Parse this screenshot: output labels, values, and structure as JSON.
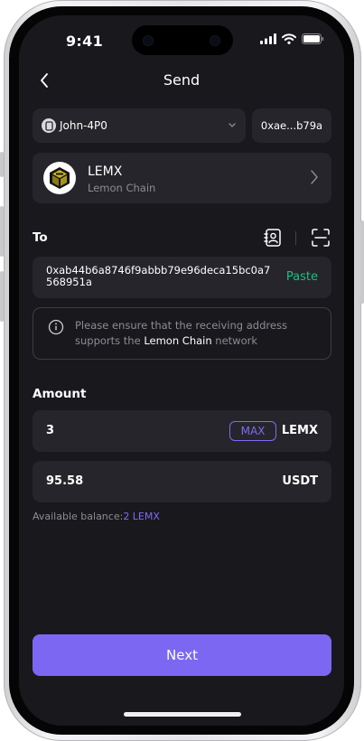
{
  "status": {
    "time": "9:41"
  },
  "header": {
    "title": "Send"
  },
  "wallet": {
    "name": "John-4P0",
    "address_short": "0xae...b79a"
  },
  "token": {
    "symbol": "LEMX",
    "network": "Lemon Chain"
  },
  "to": {
    "label": "To",
    "address": "0xab44b6a8746f9abbb79e96deca15bc0a7568951a",
    "paste_label": "Paste"
  },
  "notice": {
    "text_before": "Please ensure that the receiving address supports the ",
    "network": "Lemon Chain",
    "text_after": " network"
  },
  "amount": {
    "label": "Amount",
    "value": "3",
    "max_label": "MAX",
    "unit": "LEMX",
    "fiat_value": "95.58",
    "fiat_unit": "USDT"
  },
  "balance": {
    "label": "Available balance:",
    "value": "2 LEMX"
  },
  "actions": {
    "next_label": "Next"
  },
  "colors": {
    "accent": "#7b67f2",
    "paste": "#1ec07d",
    "background": "#19181d",
    "card": "#26252b",
    "muted": "#8d8c93"
  },
  "icons": [
    "back-icon",
    "wallet-icon",
    "chevron-down-icon",
    "lemx-logo-icon",
    "chevron-right-icon",
    "contact-book-icon",
    "scan-icon",
    "info-icon",
    "signal-icon",
    "wifi-icon",
    "battery-icon"
  ]
}
